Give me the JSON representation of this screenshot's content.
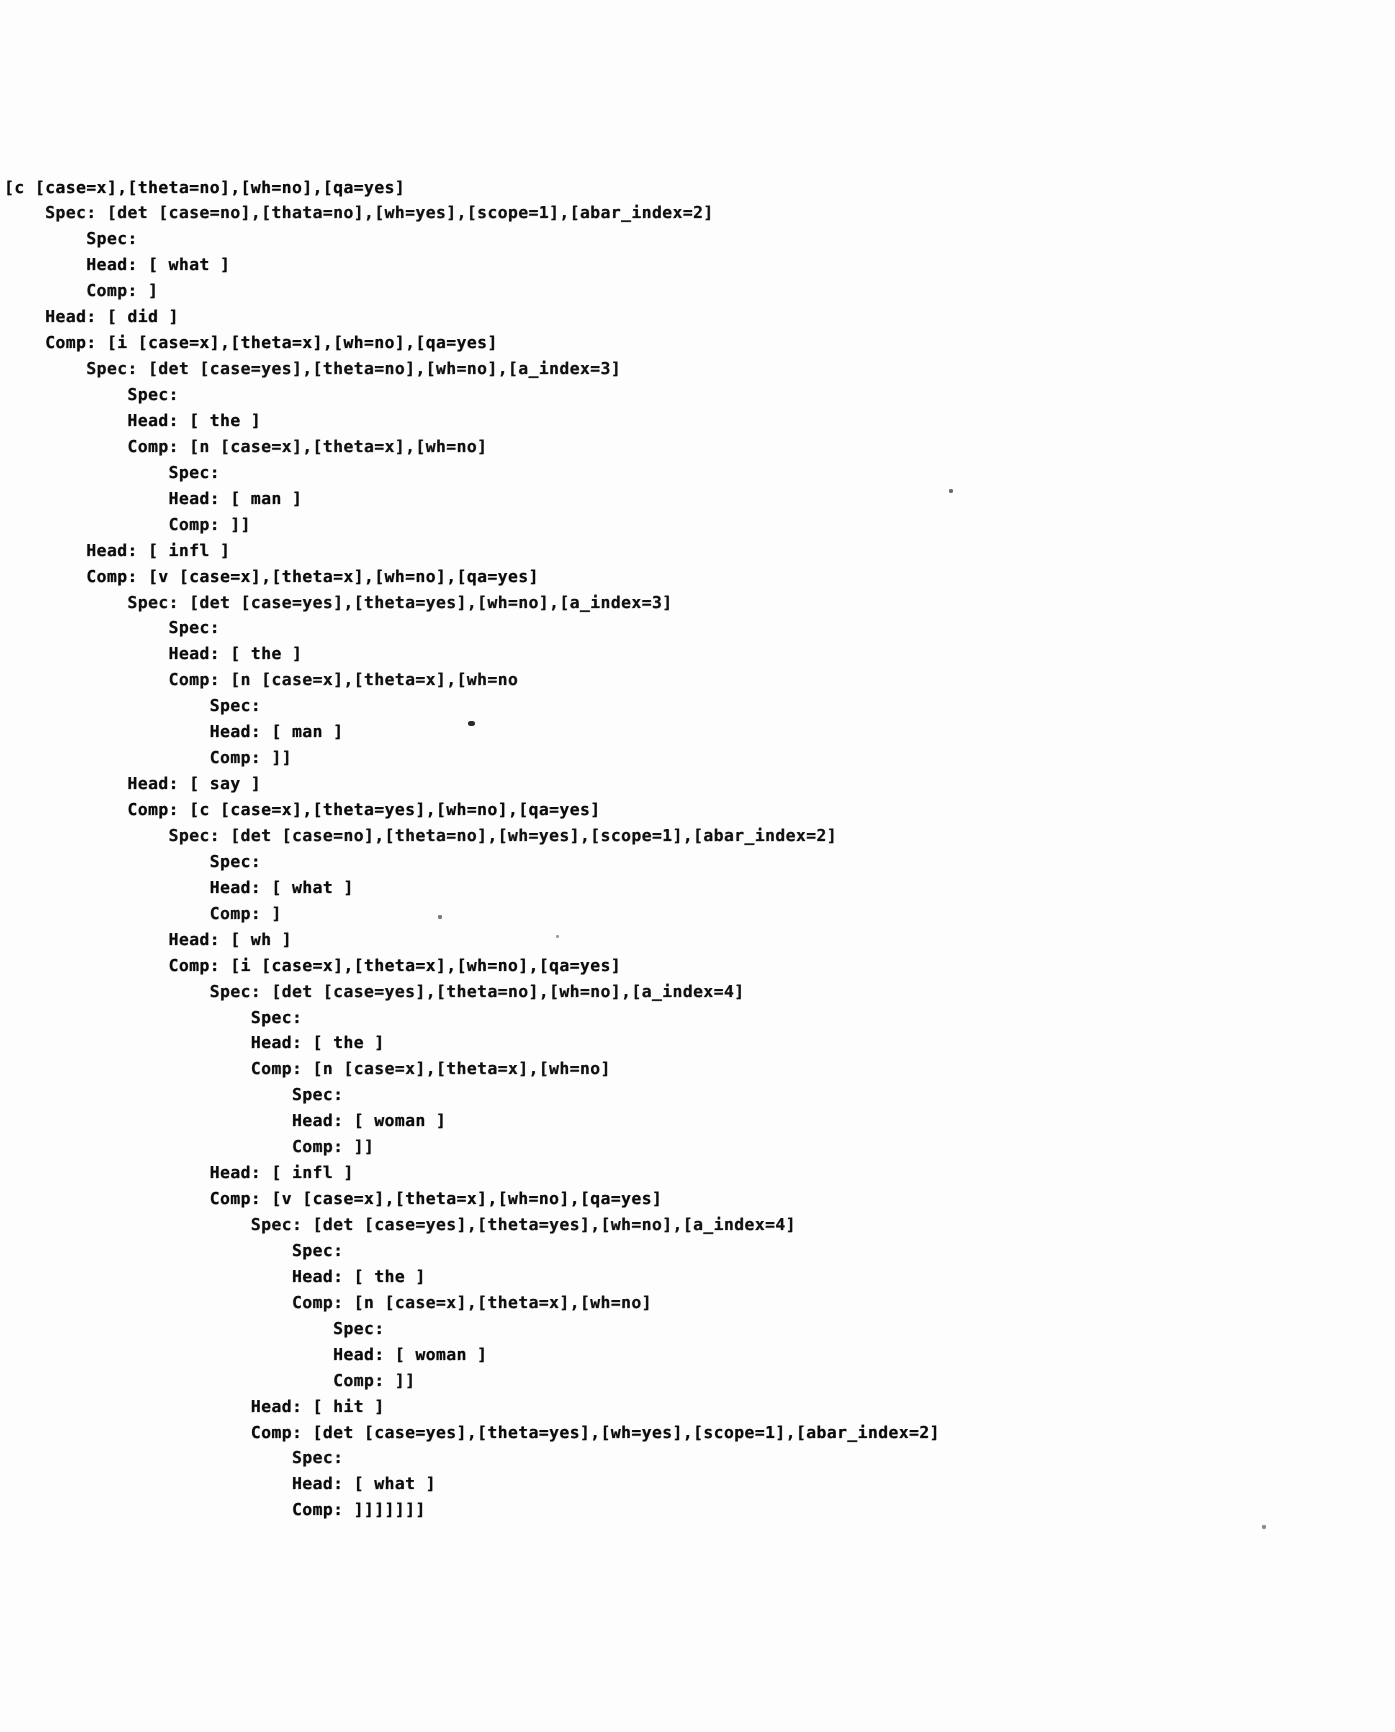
{
  "document": {
    "kind": "parse-tree-printout",
    "description": "X-bar phrase-structure parse with feature bundles",
    "ink_color": "#0b0b0b",
    "paper_color": "#fdfdfd",
    "lines": [
      "[c [case=x],[theta=no],[wh=no],[qa=yes]",
      "    Spec: [det [case=no],[thata=no],[wh=yes],[scope=1],[abar_index=2]",
      "        Spec:",
      "        Head: [ what ]",
      "        Comp: ]",
      "    Head: [ did ]",
      "    Comp: [i [case=x],[theta=x],[wh=no],[qa=yes]",
      "        Spec: [det [case=yes],[theta=no],[wh=no],[a_index=3]",
      "            Spec:",
      "            Head: [ the ]",
      "            Comp: [n [case=x],[theta=x],[wh=no]",
      "                Spec:",
      "                Head: [ man ]",
      "                Comp: ]]",
      "        Head: [ infl ]",
      "        Comp: [v [case=x],[theta=x],[wh=no],[qa=yes]",
      "            Spec: [det [case=yes],[theta=yes],[wh=no],[a_index=3]",
      "                Spec:",
      "                Head: [ the ]",
      "                Comp: [n [case=x],[theta=x],[wh=no",
      "                    Spec:",
      "                    Head: [ man ]",
      "                    Comp: ]]",
      "            Head: [ say ]",
      "            Comp: [c [case=x],[theta=yes],[wh=no],[qa=yes]",
      "                Spec: [det [case=no],[theta=no],[wh=yes],[scope=1],[abar_index=2]",
      "                    Spec:",
      "                    Head: [ what ]",
      "                    Comp: ]",
      "                Head: [ wh ]",
      "                Comp: [i [case=x],[theta=x],[wh=no],[qa=yes]",
      "                    Spec: [det [case=yes],[theta=no],[wh=no],[a_index=4]",
      "                        Spec:",
      "                        Head: [ the ]",
      "                        Comp: [n [case=x],[theta=x],[wh=no]",
      "                            Spec:",
      "                            Head: [ woman ]",
      "                            Comp: ]]",
      "                    Head: [ infl ]",
      "                    Comp: [v [case=x],[theta=x],[wh=no],[qa=yes]",
      "                        Spec: [det [case=yes],[theta=yes],[wh=no],[a_index=4]",
      "                            Spec:",
      "                            Head: [ the ]",
      "                            Comp: [n [case=x],[theta=x],[wh=no]",
      "                                Spec:",
      "                                Head: [ woman ]",
      "                                Comp: ]]",
      "                        Head: [ hit ]",
      "                        Comp: [det [case=yes],[theta=yes],[wh=yes],[scope=1],[abar_index=2]",
      "                            Spec:",
      "                            Head: [ what ]",
      "                            Comp: ]]]]]]]"
    ]
  },
  "artifacts": {
    "speck_a": "ink-speck",
    "speck_b": "ink-speck",
    "speck_c": "ink-speck",
    "speck_d": "ink-speck",
    "speck_e": "ink-speck"
  }
}
